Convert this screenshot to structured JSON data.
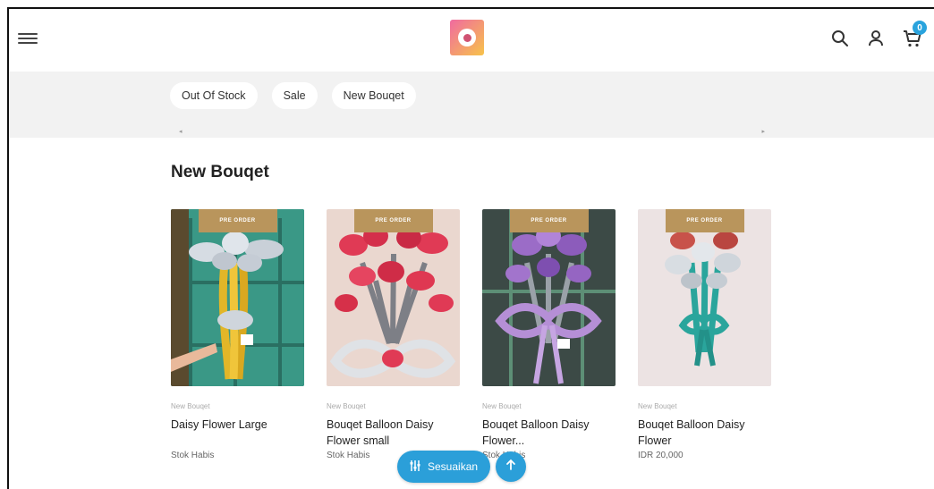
{
  "header": {
    "menu_icon": "hamburger-menu-icon",
    "logo_icon": "flower-shop-logo",
    "search_icon": "search-icon",
    "account_icon": "user-icon",
    "cart_icon": "cart-icon",
    "cart_count": "0"
  },
  "categories": {
    "items": [
      {
        "label": "Out Of Stock"
      },
      {
        "label": "Sale"
      },
      {
        "label": "New Bouqet"
      }
    ]
  },
  "section": {
    "title": "New Bouqet"
  },
  "products": [
    {
      "tag": "PRE ORDER",
      "category": "New Bouqet",
      "name": "Daisy Flower Large",
      "status": "Stok Habis",
      "balloon_color": "#d6dce3",
      "bg_color": "#2f8a7a"
    },
    {
      "tag": "PRE ORDER",
      "category": "New Bouqet",
      "name": "Bouqet Balloon Daisy Flower small",
      "status": "Stok Habis",
      "balloon_color": "#e03a55",
      "bg_color": "#ead7cf"
    },
    {
      "tag": "PRE ORDER",
      "category": "New Bouqet",
      "name": "Bouqet Balloon Daisy Flower...",
      "status": "Stok Habis",
      "balloon_color": "#9b6cc7",
      "bg_color": "#3c4a46"
    },
    {
      "tag": "PRE ORDER",
      "category": "New Bouqet",
      "name": "Bouqet Balloon Daisy Flower",
      "status": "IDR 20,000",
      "balloon_color": "#2aa59c",
      "bg_color": "#ece3e3"
    }
  ],
  "fab": {
    "customize_label": "Sesuaikan",
    "customize_icon": "sliders-icon",
    "up_icon": "arrow-up-icon"
  },
  "colors": {
    "accent": "#2b9fd9",
    "tag": "#b9955c",
    "category_bar": "#f2f2f2"
  }
}
